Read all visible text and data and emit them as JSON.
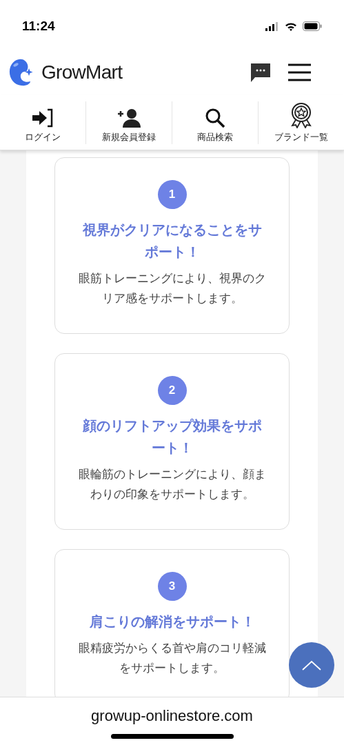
{
  "status_bar": {
    "time": "11:24"
  },
  "header": {
    "logo_text": "GrowMart"
  },
  "nav": [
    {
      "kind": "login",
      "label": "ログイン"
    },
    {
      "kind": "register",
      "label": "新規会員登録"
    },
    {
      "kind": "search",
      "label": "商品検索"
    },
    {
      "kind": "brands",
      "label": "ブランド一覧"
    }
  ],
  "cards": [
    {
      "number": "1",
      "title": "視界がクリアになることをサポート！",
      "text": "眼筋トレーニングにより、視界のクリア感をサポートします。"
    },
    {
      "number": "2",
      "title": "顔のリフトアップ効果をサポート！",
      "text": "眼輪筋のトレーニングにより、顔まわりの印象をサポートします。"
    },
    {
      "number": "3",
      "title": "肩こりの解消をサポート！",
      "text": "眼精疲労からくる首や肩のコリ軽減をサポートします。"
    }
  ],
  "url_bar": {
    "url": "growup-onlinestore.com"
  }
}
